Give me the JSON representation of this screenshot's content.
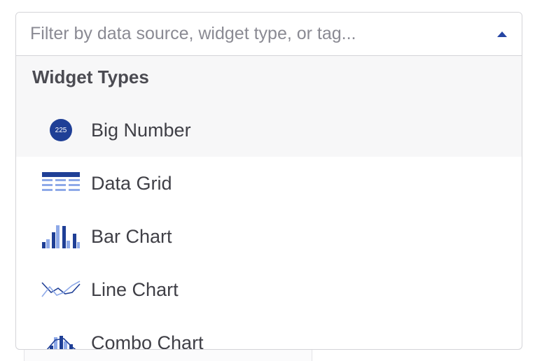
{
  "filter": {
    "placeholder": "Filter by data source, widget type, or tag..."
  },
  "group": {
    "title": "Widget Types"
  },
  "items": [
    {
      "label": "Big Number",
      "icon": "big-number-icon",
      "icon_text": "225",
      "highlighted": true
    },
    {
      "label": "Data Grid",
      "icon": "data-grid-icon"
    },
    {
      "label": "Bar Chart",
      "icon": "bar-chart-icon"
    },
    {
      "label": "Line Chart",
      "icon": "line-chart-icon"
    },
    {
      "label": "Combo Chart",
      "icon": "combo-chart-icon"
    }
  ],
  "colors": {
    "accent_dark": "#1f3f96",
    "accent_light": "#8ea9e8",
    "caret": "#2545a3"
  }
}
